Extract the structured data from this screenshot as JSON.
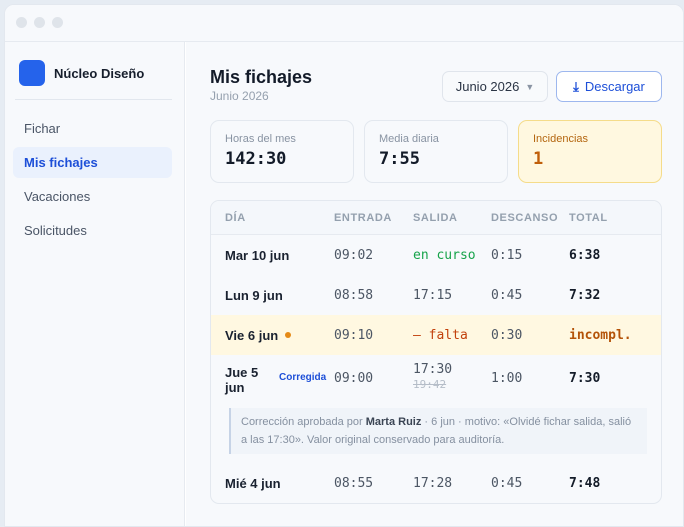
{
  "brand": {
    "name": "Núcleo Diseño"
  },
  "sidebar": {
    "items": [
      {
        "label": "Fichar"
      },
      {
        "label": "Mis fichajes"
      },
      {
        "label": "Vacaciones"
      },
      {
        "label": "Solicitudes"
      }
    ]
  },
  "header": {
    "title": "Mis fichajes",
    "subtitle": "Junio 2026",
    "month_select": "Junio 2026",
    "download_label": "Descargar"
  },
  "stats": [
    {
      "label": "Horas del mes",
      "value": "142:30"
    },
    {
      "label": "Media diaria",
      "value": "7:55"
    },
    {
      "label": "Incidencias",
      "value": "1"
    }
  ],
  "table": {
    "columns": [
      "DÍA",
      "ENTRADA",
      "SALIDA",
      "DESCANSO",
      "TOTAL"
    ],
    "rows": [
      {
        "day": "Mar 10 jun",
        "entrada": "09:02",
        "salida": "en curso",
        "descanso": "0:15",
        "total": "6:38"
      },
      {
        "day": "Lun 9 jun",
        "entrada": "08:58",
        "salida": "17:15",
        "descanso": "0:45",
        "total": "7:32"
      },
      {
        "day": "Vie 6 jun",
        "entrada": "09:10",
        "salida": "— falta",
        "descanso": "0:30",
        "total": "incompl."
      },
      {
        "day_line1": "Jue 5",
        "day_line2": "jun",
        "badge": "Corregida",
        "entrada": "09:00",
        "salida": "17:30",
        "salida_original": "19:42",
        "descanso": "1:00",
        "total": "7:30"
      },
      {
        "day": "Mié 4 jun",
        "entrada": "08:55",
        "salida": "17:28",
        "descanso": "0:45",
        "total": "7:48"
      }
    ],
    "correction_note": {
      "prefix": "Corrección aprobada por ",
      "approver": "Marta Ruiz",
      "text": " · 6 jun · motivo: «Olvidé fichar salida, salió a las 17:30». Valor original conservado para auditoría."
    }
  },
  "colors": {
    "accent": "#1d4fd8",
    "brand": "#2563eb",
    "warning_bg": "#fff8e0",
    "warning_text": "#c05f0a",
    "success": "#16a34a"
  },
  "icons": {
    "download": "download-icon",
    "select": "chevron-down-icon"
  }
}
